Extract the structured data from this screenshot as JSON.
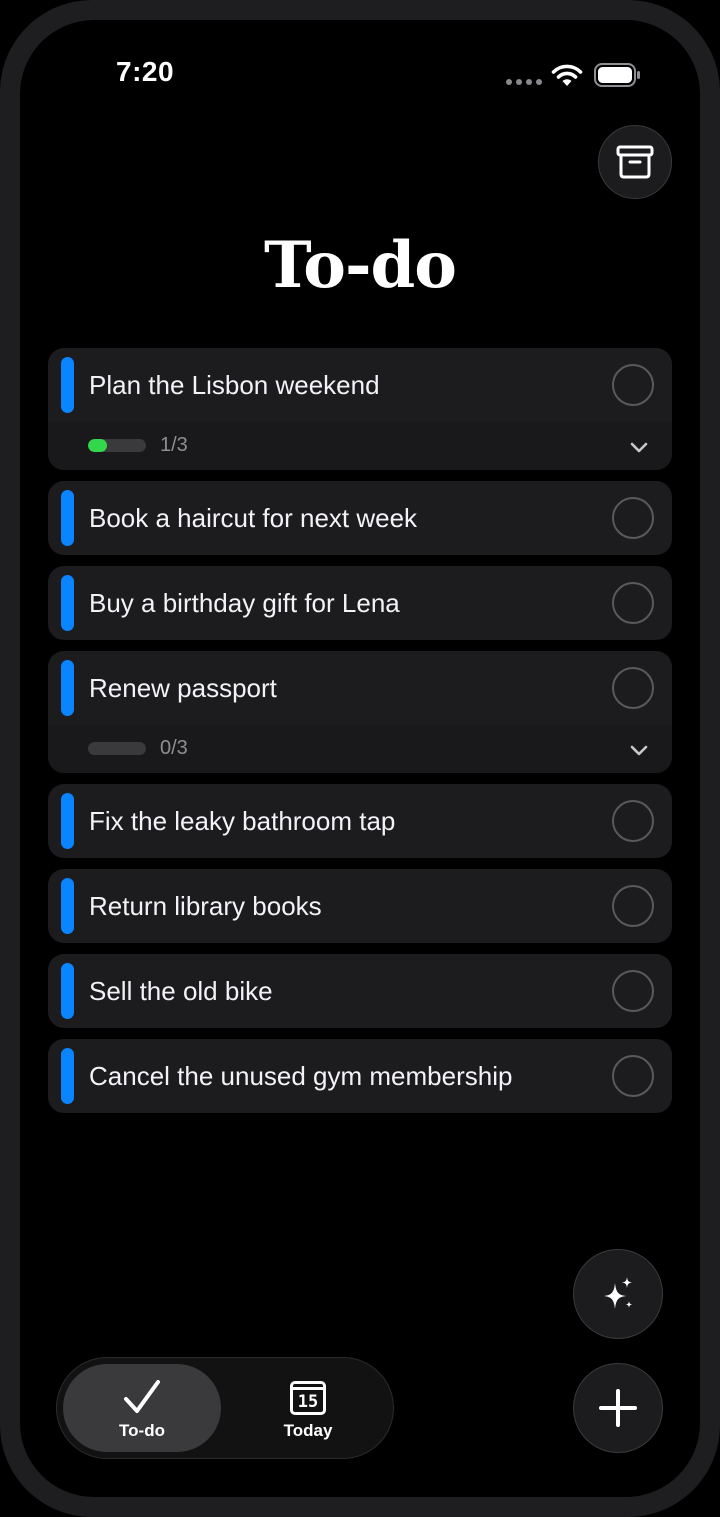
{
  "status_bar": {
    "time": "7:20"
  },
  "header": {
    "title": "To-do",
    "archive_icon": "archive-box-icon"
  },
  "tasks": [
    {
      "text": "Plan the Lisbon weekend",
      "subtasks": {
        "progress": "1/3",
        "done": 1,
        "total": 3
      }
    },
    {
      "text": "Book a haircut for next week"
    },
    {
      "text": "Buy a birthday gift for Lena"
    },
    {
      "text": "Renew passport",
      "subtasks": {
        "progress": "0/3",
        "done": 0,
        "total": 3
      }
    },
    {
      "text": "Fix the leaky bathroom tap"
    },
    {
      "text": "Return library books"
    },
    {
      "text": "Sell the old bike"
    },
    {
      "text": "Cancel the unused gym membership"
    }
  ],
  "tabbar": {
    "tabs": [
      {
        "label": "To-do",
        "icon": "checkmark-icon",
        "active": true
      },
      {
        "label": "Today",
        "icon": "calendar-icon",
        "calendar_day": "15",
        "active": false
      }
    ]
  },
  "fabs": {
    "sparkle_icon": "sparkle-icon",
    "add_icon": "plus-icon"
  },
  "colors": {
    "accent": "#0a84ff",
    "progress": "#32d74b",
    "card": "#1c1c1e",
    "background": "#000000"
  }
}
